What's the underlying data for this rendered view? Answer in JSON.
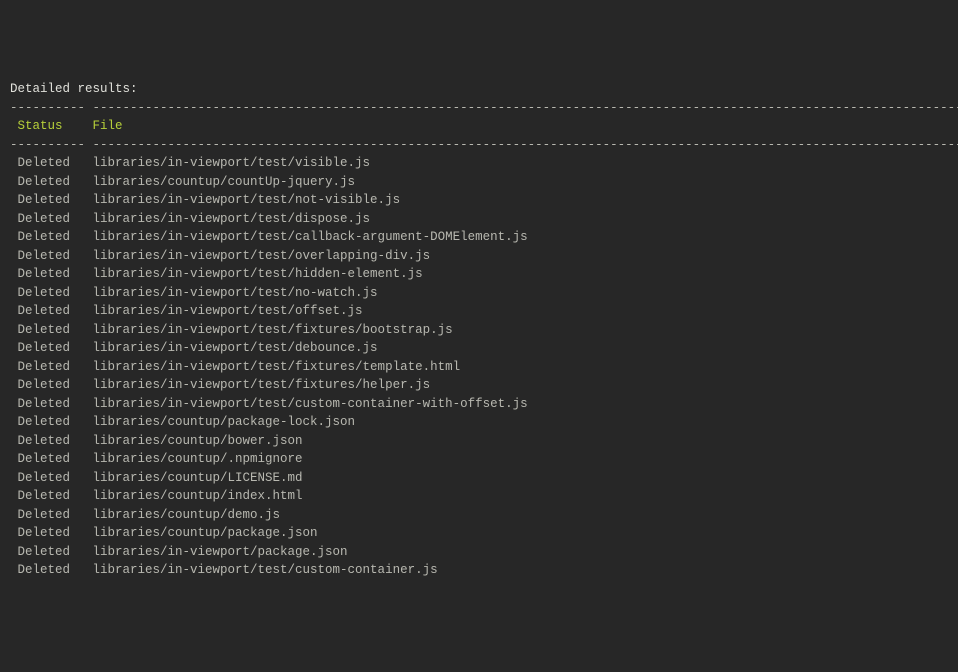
{
  "title": "Detailed results:",
  "columns": {
    "status": {
      "label": "Status",
      "width": 10
    },
    "file": {
      "label": "File"
    }
  },
  "rule_segments": {
    "status": "----------",
    "file": "----------------------------------------------------------------------------------------------------------------------------------"
  },
  "rows": [
    {
      "status": "Deleted",
      "file": "libraries/in-viewport/test/visible.js"
    },
    {
      "status": "Deleted",
      "file": "libraries/countup/countUp-jquery.js"
    },
    {
      "status": "Deleted",
      "file": "libraries/in-viewport/test/not-visible.js"
    },
    {
      "status": "Deleted",
      "file": "libraries/in-viewport/test/dispose.js"
    },
    {
      "status": "Deleted",
      "file": "libraries/in-viewport/test/callback-argument-DOMElement.js"
    },
    {
      "status": "Deleted",
      "file": "libraries/in-viewport/test/overlapping-div.js"
    },
    {
      "status": "Deleted",
      "file": "libraries/in-viewport/test/hidden-element.js"
    },
    {
      "status": "Deleted",
      "file": "libraries/in-viewport/test/no-watch.js"
    },
    {
      "status": "Deleted",
      "file": "libraries/in-viewport/test/offset.js"
    },
    {
      "status": "Deleted",
      "file": "libraries/in-viewport/test/fixtures/bootstrap.js"
    },
    {
      "status": "Deleted",
      "file": "libraries/in-viewport/test/debounce.js"
    },
    {
      "status": "Deleted",
      "file": "libraries/in-viewport/test/fixtures/template.html"
    },
    {
      "status": "Deleted",
      "file": "libraries/in-viewport/test/fixtures/helper.js"
    },
    {
      "status": "Deleted",
      "file": "libraries/in-viewport/test/custom-container-with-offset.js"
    },
    {
      "status": "Deleted",
      "file": "libraries/countup/package-lock.json"
    },
    {
      "status": "Deleted",
      "file": "libraries/countup/bower.json"
    },
    {
      "status": "Deleted",
      "file": "libraries/countup/.npmignore"
    },
    {
      "status": "Deleted",
      "file": "libraries/countup/LICENSE.md"
    },
    {
      "status": "Deleted",
      "file": "libraries/countup/index.html"
    },
    {
      "status": "Deleted",
      "file": "libraries/countup/demo.js"
    },
    {
      "status": "Deleted",
      "file": "libraries/countup/package.json"
    },
    {
      "status": "Deleted",
      "file": "libraries/in-viewport/package.json"
    },
    {
      "status": "Deleted",
      "file": "libraries/in-viewport/test/custom-container.js"
    }
  ]
}
